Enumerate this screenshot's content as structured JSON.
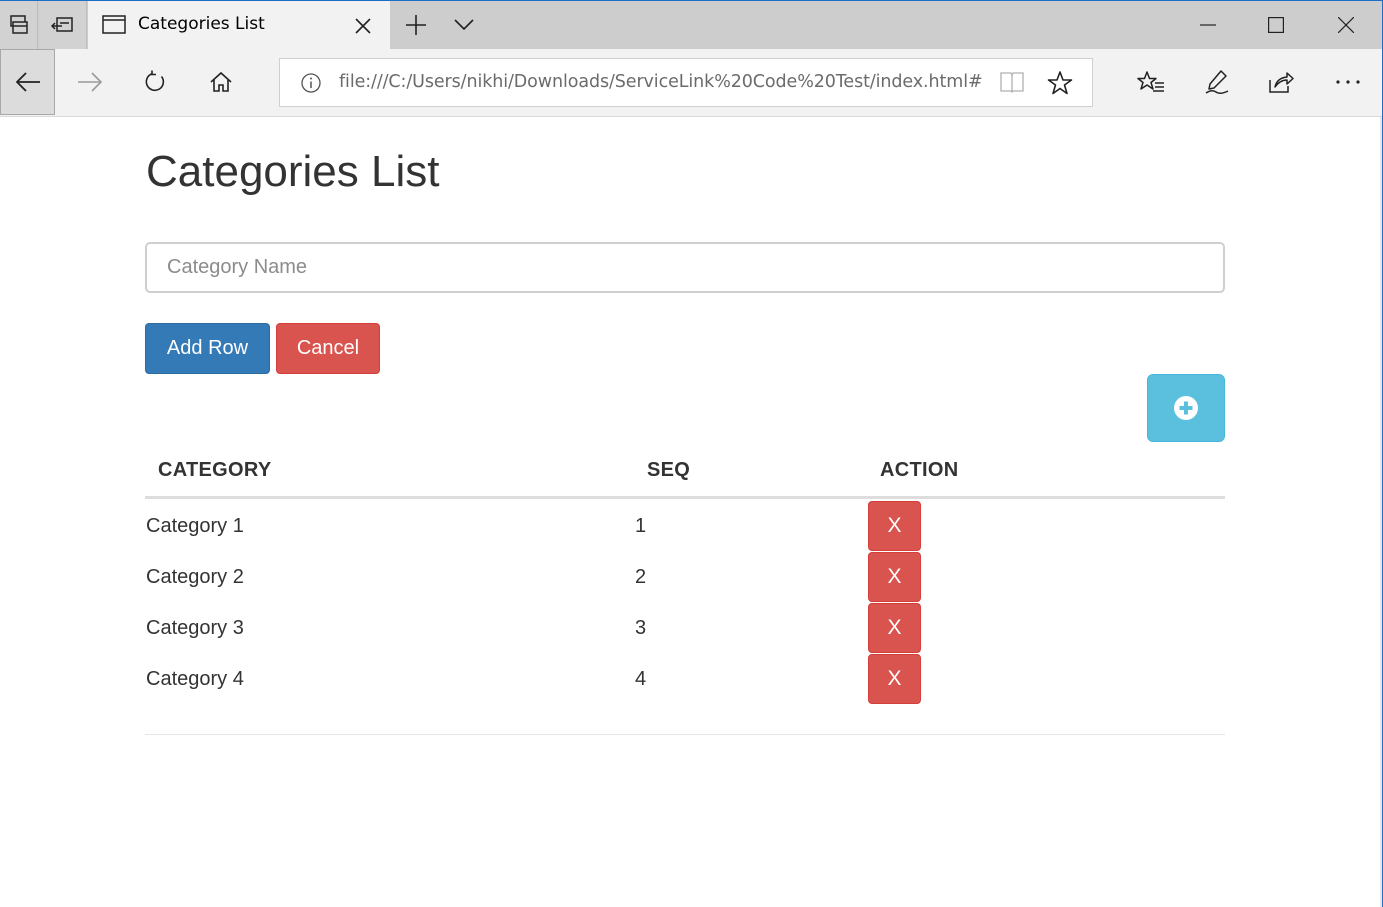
{
  "browser": {
    "tab_title": "Categories List",
    "url": "file:///C:/Users/nikhi/Downloads/ServiceLink%20Code%20Test/index.html#"
  },
  "page": {
    "title": "Categories List",
    "input_placeholder": "Category Name",
    "input_value": "",
    "add_row_label": "Add Row",
    "cancel_label": "Cancel",
    "add_icon": "plus-circle-icon"
  },
  "table": {
    "headers": {
      "category": "CATEGORY",
      "seq": "SEQ",
      "action": "ACTION"
    },
    "delete_label": "X",
    "rows": [
      {
        "category": "Category 1",
        "seq": "1"
      },
      {
        "category": "Category 2",
        "seq": "2"
      },
      {
        "category": "Category 3",
        "seq": "3"
      },
      {
        "category": "Category 4",
        "seq": "4"
      }
    ]
  },
  "colors": {
    "primary": "#337ab7",
    "danger": "#d9534f",
    "info": "#5bc0de",
    "text": "#333333"
  }
}
